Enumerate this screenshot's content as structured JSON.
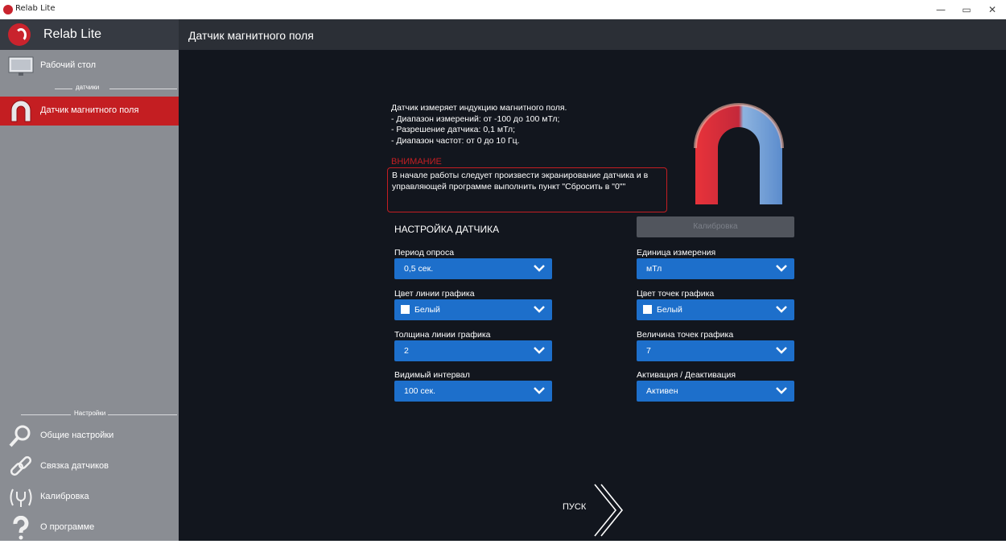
{
  "window": {
    "title": "Relab Lite",
    "minimize": "—",
    "maximize": "▭",
    "close": "✕"
  },
  "sidebar": {
    "app_title": "Relab Lite",
    "items": [
      {
        "label": "Рабочий стол",
        "icon": "monitor-icon"
      },
      {
        "label": "Датчик магнитного поля",
        "icon": "magnet-icon",
        "active": true
      },
      {
        "label": "Общие настройки",
        "icon": "magnifier-icon"
      },
      {
        "label": "Связка датчиков",
        "icon": "chain-link-icon"
      },
      {
        "label": "Калибровка",
        "icon": "calibration-signal-icon"
      },
      {
        "label": "О программе",
        "icon": "question-icon"
      }
    ],
    "section_sensors": "датчики",
    "section_settings": "Настройки"
  },
  "main": {
    "page_title": "Датчик магнитного поля",
    "info_lines": [
      "Датчик измеряет индукцию магнитного поля.",
      "- Диапазон измерений: от  -100 до 100 мТл;",
      "- Разрешение датчика: 0,1 мТл;",
      "- Диапазон частот: от 0 до 10 Гц."
    ],
    "warning_title": "ВНИМАНИЕ",
    "warning_text": "В начале работы следует произвести экранирование датчика и в управляющей программе выполнить пункт \"Сбросить в \"0\"\"",
    "calibration_button": "Калибровка",
    "settings_title": "НАСТРОЙКА ДАТЧИКА",
    "fields": {
      "poll_period": {
        "label": "Период опроса",
        "value": "0,5 сек."
      },
      "unit": {
        "label": "Единица измерения",
        "value": "мТл"
      },
      "line_color": {
        "label": "Цвет линии графика",
        "value": "Белый"
      },
      "point_color": {
        "label": "Цвет точек графика",
        "value": "Белый"
      },
      "line_width": {
        "label": "Толщина линии графика",
        "value": "2"
      },
      "point_size": {
        "label": "Величина точек графика",
        "value": "7"
      },
      "visible_interval": {
        "label": "Видимый интервал",
        "value": "100 сек."
      },
      "activation": {
        "label": "Активация / Деактивация",
        "value": "Активен"
      }
    },
    "start_label": "ПУСК"
  },
  "colors": {
    "accent_red": "#c41e22",
    "select_blue": "#1d6fcb",
    "sidebar_bg": "#8a8d93",
    "main_bg": "#12161e"
  }
}
